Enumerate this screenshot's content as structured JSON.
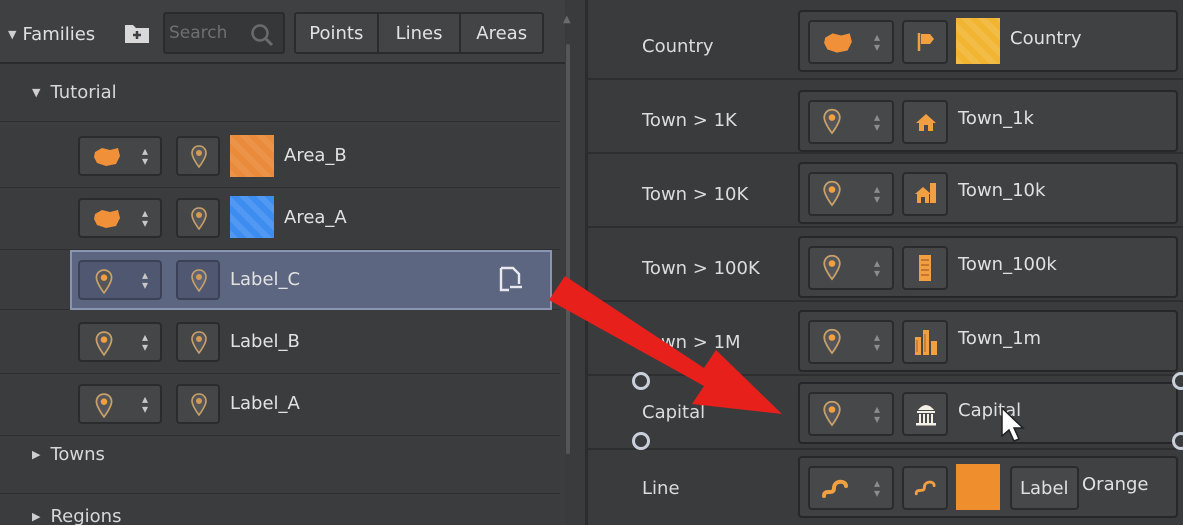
{
  "families_panel": {
    "title": "Families",
    "search_placeholder": "Search",
    "type_tabs": [
      "Points",
      "Lines",
      "Areas"
    ],
    "groups": {
      "tutorial": "Tutorial",
      "towns": "Towns",
      "regions": "Regions"
    },
    "families": [
      {
        "name": "Area_B",
        "geometry": "area",
        "swatch": "#ea8a3b"
      },
      {
        "name": "Area_A",
        "geometry": "area",
        "swatch": "#3d8df0"
      },
      {
        "name": "Label_C",
        "geometry": "point",
        "selected": true
      },
      {
        "name": "Label_B",
        "geometry": "point"
      },
      {
        "name": "Label_A",
        "geometry": "point"
      }
    ]
  },
  "rules_panel": {
    "rules": [
      {
        "label": "Country",
        "name": "Country",
        "geometry": "area",
        "icon": "flag-icon",
        "swatch": "#f1b532"
      },
      {
        "label": "Town > 1K",
        "name": "Town_1k",
        "geometry": "point",
        "icon": "house-icon"
      },
      {
        "label": "Town > 10K",
        "name": "Town_10k",
        "geometry": "point",
        "icon": "house-tower-icon"
      },
      {
        "label": "Town > 100K",
        "name": "Town_100k",
        "geometry": "point",
        "icon": "building-icon"
      },
      {
        "label": "Town > 1M",
        "name": "Town_1m",
        "geometry": "point",
        "icon": "skyline-icon"
      },
      {
        "label": "Capital",
        "name": "Capital",
        "geometry": "point",
        "icon": "capitol-icon"
      },
      {
        "label": "Line",
        "name": "Orange",
        "geometry": "line",
        "icon": "line-icon",
        "swatch": "#ee8e2c",
        "tag": "Label"
      }
    ]
  },
  "colors": {
    "accent_orange": "#f0a040",
    "selection": "#5c6680",
    "arrow": "#e8201c"
  }
}
